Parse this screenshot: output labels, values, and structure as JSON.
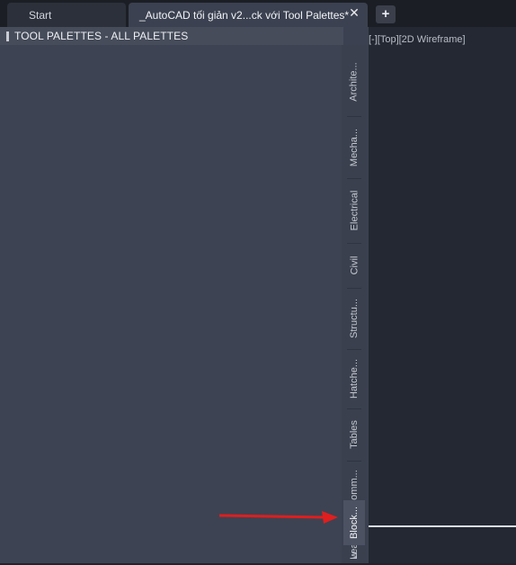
{
  "tabs": {
    "start_label": "Start",
    "document_label": "_AutoCAD tối giản v2...ck với Tool Palettes*",
    "close_glyph": "✕",
    "new_glyph": "+"
  },
  "palette": {
    "title": "TOOL PALETTES - ALL PALETTES",
    "tabs": [
      "Archite...",
      "Mecha...",
      "Electrical",
      "Civil",
      "Structu...",
      "Hatche...",
      "Tables",
      "Comm...",
      "Leaders",
      "Block...",
      "w"
    ],
    "active_tab": "Block..."
  },
  "viewport": {
    "label": "[-][Top][2D Wireframe]"
  },
  "colors": {
    "annotation_arrow": "#e01e1e",
    "panel_bg": "#3d4352",
    "viewport_bg": "#232832"
  }
}
